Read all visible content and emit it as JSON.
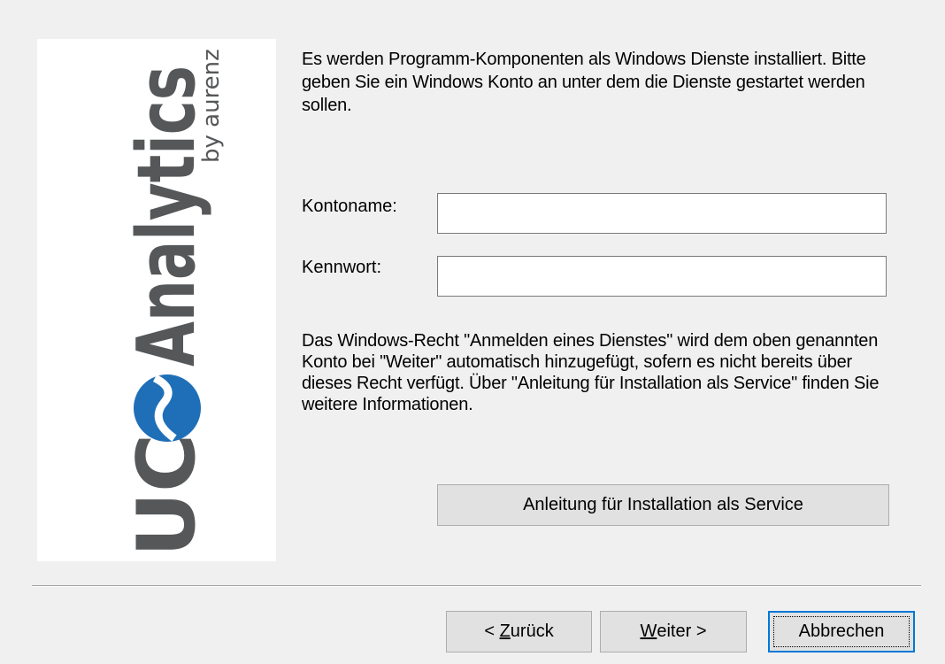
{
  "logo": {
    "brand_uc": "UC",
    "brand_analytics": "Analytics",
    "brand_by": "by aurenz",
    "colors": {
      "dark": "#555759",
      "blue": "#1f6fb8"
    }
  },
  "intro": {
    "text": "Es werden Programm-Komponenten als Windows Dienste installiert. Bitte geben Sie ein Windows Konto an unter dem die Dienste gestartet werden sollen."
  },
  "form": {
    "account_label": "Kontoname:",
    "account_value": "",
    "password_label": "Kennwort:",
    "password_value": ""
  },
  "info": {
    "text": "Das Windows-Recht \"Anmelden eines Dienstes\" wird dem oben genannten Konto bei \"Weiter\" automatisch hinzugefügt, sofern es nicht bereits über dieses Recht verfügt. Über \"Anleitung für Installation als Service\" finden Sie weitere Informationen."
  },
  "buttons": {
    "service_guide": "Anleitung für Installation als Service",
    "back_prefix": "< ",
    "back_mnemonic": "Z",
    "back_rest": "urück",
    "next_mnemonic": "W",
    "next_rest": "eiter >",
    "cancel": "Abbrechen"
  },
  "colors": {
    "window_bg": "#f0f0f0",
    "focus_border": "#0078d7"
  }
}
